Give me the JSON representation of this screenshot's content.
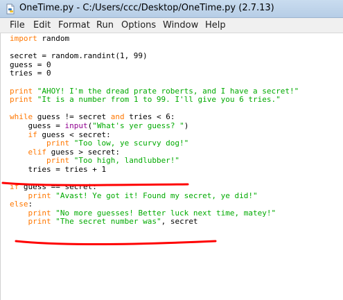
{
  "window": {
    "title": "OneTime.py - C:/Users/ccc/Desktop/OneTime.py (2.7.13)"
  },
  "menu": {
    "items": [
      "File",
      "Edit",
      "Format",
      "Run",
      "Options",
      "Window",
      "Help"
    ]
  },
  "code": {
    "lines": [
      [
        [
          "kw",
          "import"
        ],
        [
          "p",
          " random"
        ]
      ],
      [],
      [
        [
          "p",
          "secret = random.randint(1, 99)"
        ]
      ],
      [
        [
          "p",
          "guess = 0"
        ]
      ],
      [
        [
          "p",
          "tries = 0"
        ]
      ],
      [],
      [
        [
          "kw",
          "print"
        ],
        [
          "p",
          " "
        ],
        [
          "str",
          "\"AHOY! I'm the dread prate roberts, and I have a secret!\""
        ]
      ],
      [
        [
          "kw",
          "print"
        ],
        [
          "p",
          " "
        ],
        [
          "str",
          "\"It is a number from 1 to 99. I'll give you 6 tries.\""
        ]
      ],
      [],
      [
        [
          "kw",
          "while"
        ],
        [
          "p",
          " guess != secret "
        ],
        [
          "kw",
          "and"
        ],
        [
          "p",
          " tries < 6:"
        ]
      ],
      [
        [
          "p",
          "    guess = "
        ],
        [
          "bi",
          "input"
        ],
        [
          "p",
          "("
        ],
        [
          "str",
          "\"What's yer guess? \""
        ],
        [
          "p",
          ")"
        ]
      ],
      [
        [
          "p",
          "    "
        ],
        [
          "kw",
          "if"
        ],
        [
          "p",
          " guess < secret:"
        ]
      ],
      [
        [
          "p",
          "        "
        ],
        [
          "kw",
          "print"
        ],
        [
          "p",
          " "
        ],
        [
          "str",
          "\"Too low, ye scurvy dog!\""
        ]
      ],
      [
        [
          "p",
          "    "
        ],
        [
          "kw",
          "elif"
        ],
        [
          "p",
          " guess > secret:"
        ]
      ],
      [
        [
          "p",
          "        "
        ],
        [
          "kw",
          "print"
        ],
        [
          "p",
          " "
        ],
        [
          "str",
          "\"Too high, landlubber!\""
        ]
      ],
      [
        [
          "p",
          "    tries = tries + 1"
        ]
      ],
      [],
      [
        [
          "kw",
          "if"
        ],
        [
          "p",
          " guess == secret:"
        ]
      ],
      [
        [
          "p",
          "    "
        ],
        [
          "kw",
          "print"
        ],
        [
          "p",
          " "
        ],
        [
          "str",
          "\"Avast! Ye got it! Found my secret, ye did!\""
        ]
      ],
      [
        [
          "kw",
          "else"
        ],
        [
          "p",
          ":"
        ]
      ],
      [
        [
          "p",
          "    "
        ],
        [
          "kw",
          "print"
        ],
        [
          "p",
          " "
        ],
        [
          "str",
          "\"No more guesses! Better luck next time, matey!\""
        ]
      ],
      [
        [
          "p",
          "    "
        ],
        [
          "kw",
          "print"
        ],
        [
          "p",
          " "
        ],
        [
          "str",
          "\"The secret number was\""
        ],
        [
          "p",
          ", secret"
        ]
      ]
    ]
  },
  "colors": {
    "keyword": "#ff7700",
    "builtin": "#900090",
    "string": "#00aa00",
    "annotation": "#ff0000"
  }
}
